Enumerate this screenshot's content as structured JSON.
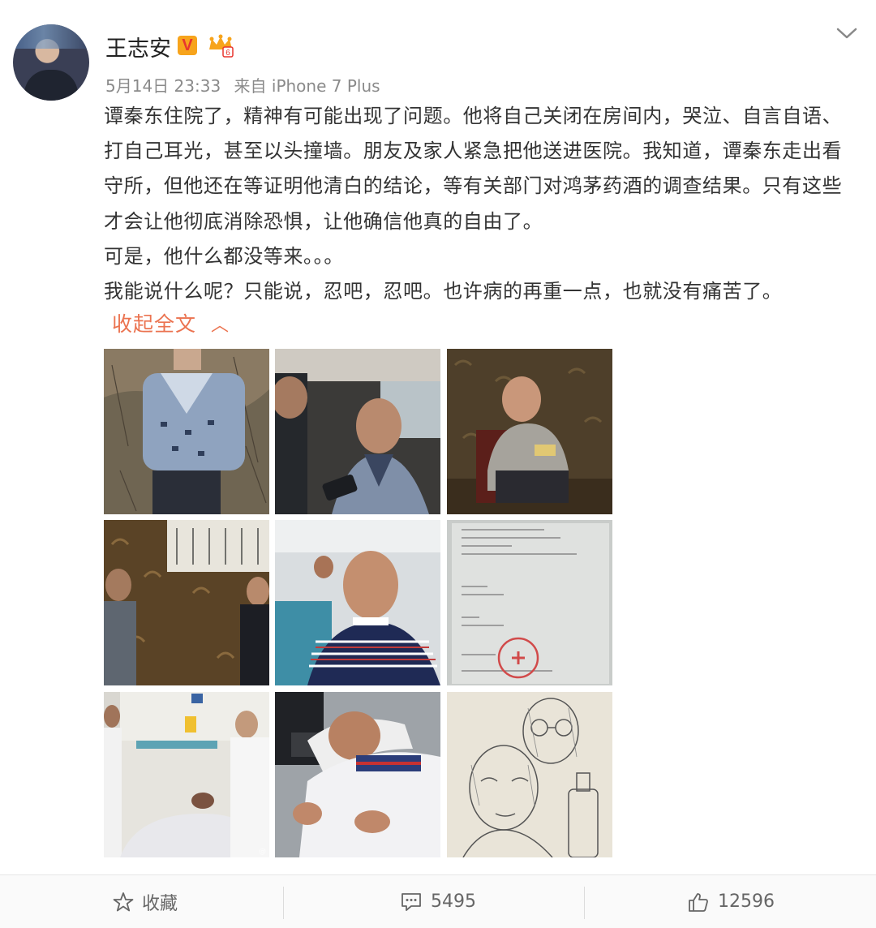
{
  "post": {
    "author": "王志安",
    "verified_badge": "V",
    "timestamp": "5月14日 23:33",
    "source": "来自 iPhone 7 Plus",
    "paragraphs": [
      "谭秦东住院了，精神有可能出现了问题。他将自己关闭在房间内，哭泣、自言自语、打自己耳光，甚至以头撞墙。朋友及家人紧急把他送进医院。我知道，谭秦东走出看守所，但他还在等证明他清白的结论，等有关部门对鸿茅药酒的调查结果。只有这些才会让他彻底消除恐惧，让他确信他真的自由了。",
      "可是，他什么都没等来。。。",
      "我能说什么呢？只能说，忍吧，忍吧。也许病的再重一点，也就没有痛苦了。"
    ],
    "collapse_label": "收起全文",
    "image_count": 9
  },
  "actions": {
    "favorite_label": "收藏",
    "comment_count": "5495",
    "like_count": "12596"
  },
  "colors": {
    "link_orange": "#eb7350",
    "badge_orange": "#f7a41c",
    "text": "#333333",
    "meta": "#8a8a8a"
  }
}
